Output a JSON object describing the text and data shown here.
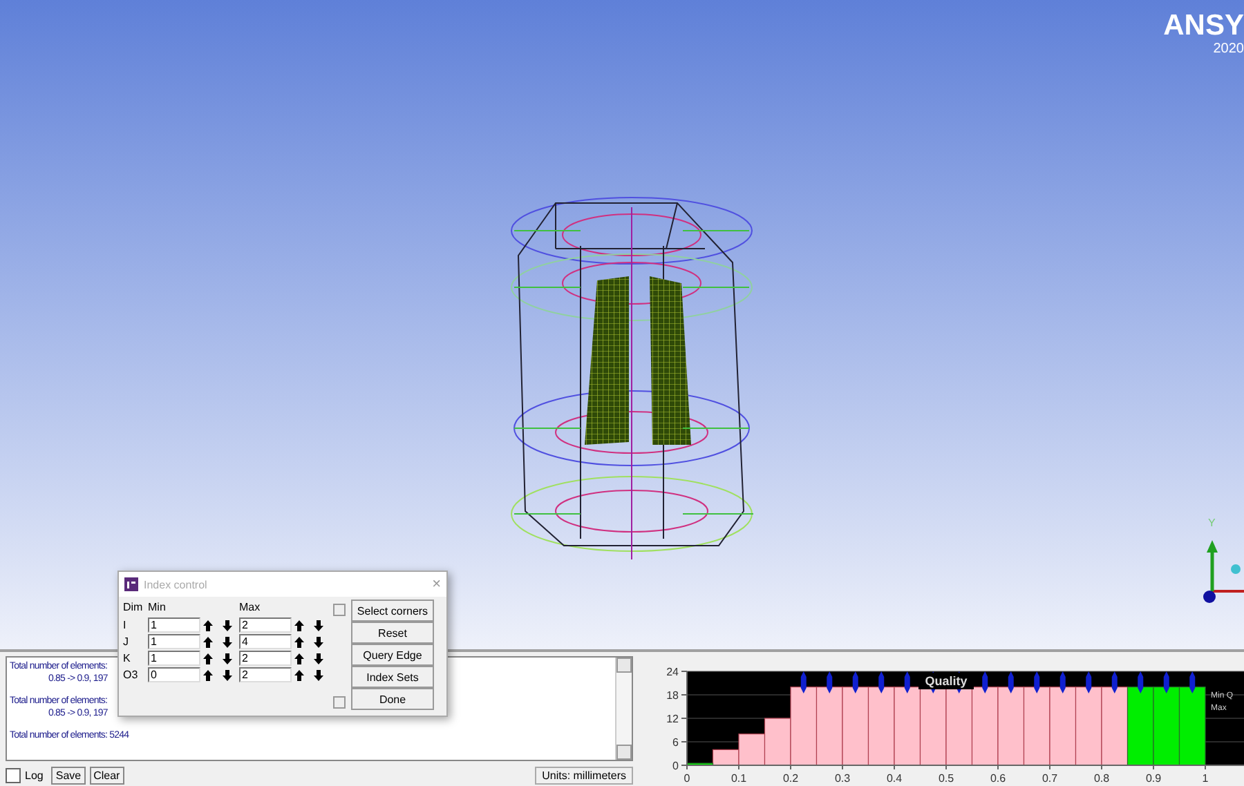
{
  "viewport": {
    "logo": {
      "text": "ANSY",
      "version": "2020"
    },
    "triad": {
      "y_label": "Y"
    }
  },
  "dialog": {
    "title": "Index control",
    "close": "×",
    "columns": [
      "Dim",
      "Min",
      "Max"
    ],
    "rows": [
      {
        "dim": "I",
        "min": "1",
        "max": "2"
      },
      {
        "dim": "J",
        "min": "1",
        "max": "4"
      },
      {
        "dim": "K",
        "min": "1",
        "max": "2"
      },
      {
        "dim": "O3",
        "min": "0",
        "max": "2"
      }
    ],
    "buttons": [
      "Select corners",
      "Reset",
      "Query Edge",
      "Index Sets",
      "Done"
    ]
  },
  "log": {
    "lines": [
      {
        "kind": "heading",
        "text": "Total number of elements:"
      },
      {
        "kind": "detail",
        "text": "0.85 -> 0.9, 197"
      },
      {
        "kind": "heading",
        "text": "Total number of elements:"
      },
      {
        "kind": "detail",
        "text": "0.85 -> 0.9, 197"
      },
      {
        "kind": "heading",
        "text": "Total number of elements: 5244"
      }
    ],
    "log_checkbox": {
      "label": "Log",
      "checked": false
    },
    "buttons": [
      "Save",
      "Clear"
    ],
    "units": "Units: millimeters"
  },
  "histogram": {
    "legend": [
      "Min Q",
      "Max"
    ],
    "chart_data": {
      "type": "bar",
      "title": "Quality",
      "x": [
        0.025,
        0.075,
        0.125,
        0.175,
        0.225,
        0.275,
        0.325,
        0.375,
        0.425,
        0.475,
        0.525,
        0.575,
        0.625,
        0.675,
        0.725,
        0.775,
        0.825,
        0.875,
        0.925,
        0.975
      ],
      "grid": true,
      "series": [
        {
          "color": "#ffc0cb",
          "values": [
            null,
            4,
            8,
            12,
            20,
            20,
            20,
            20,
            20,
            20,
            20,
            20,
            20,
            20,
            20,
            20,
            20,
            null,
            null,
            null
          ]
        },
        {
          "color": "#00ee00",
          "values": [
            0,
            null,
            null,
            null,
            null,
            null,
            null,
            null,
            null,
            null,
            null,
            null,
            null,
            null,
            null,
            null,
            null,
            20,
            20,
            20
          ]
        }
      ],
      "xlim": [
        0,
        1
      ],
      "ylim": [
        0,
        24
      ],
      "xticks": [
        0,
        0.1,
        0.2,
        0.3,
        0.4,
        0.5,
        0.6,
        0.7,
        0.8,
        0.9,
        1
      ],
      "yticks": [
        0,
        6,
        12,
        18,
        24
      ]
    }
  }
}
